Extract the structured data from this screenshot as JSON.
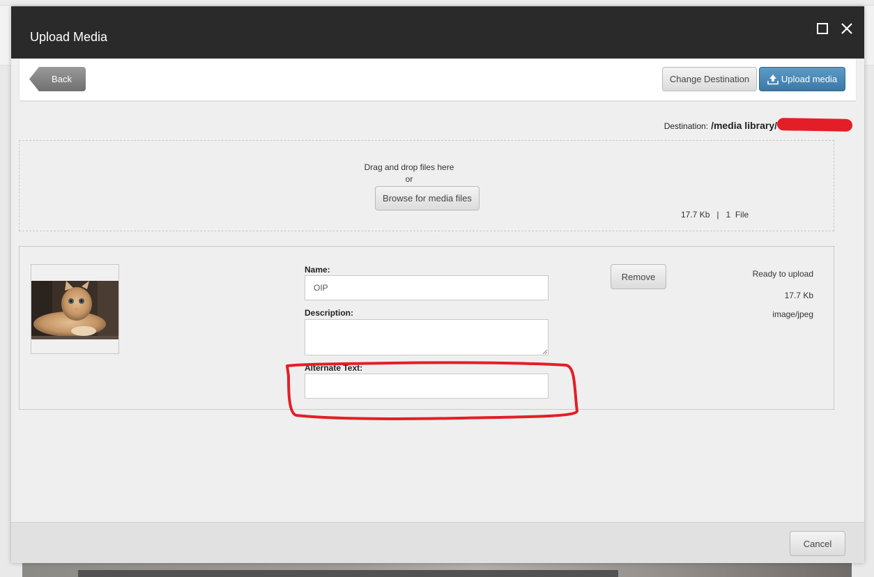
{
  "dialog": {
    "title": "Upload Media",
    "window_controls": {
      "maximize_icon": "maximize-square-icon",
      "close_icon": "close-x-icon"
    }
  },
  "toolbar": {
    "back_label": "Back",
    "change_destination_label": "Change Destination",
    "upload_label": "Upload media",
    "upload_icon": "upload-arrow-icon",
    "upload_color": "#4a88b8"
  },
  "destination": {
    "label": "Destination:",
    "path": "/media library/"
  },
  "dropzone": {
    "instruction": "Drag and drop files here",
    "or": "or",
    "browse_label": "Browse for media files",
    "summary": "17.7 Kb   |   1  File"
  },
  "file": {
    "thumbnail_alt": "kitten photo",
    "fields": {
      "name_label": "Name:",
      "name_value": "OIP",
      "description_label": "Description:",
      "description_value": "",
      "alt_label": "Alternate Text:",
      "alt_value": ""
    },
    "remove_label": "Remove",
    "status": "Ready to upload",
    "size": "17.7 Kb",
    "mime": "image/jpeg"
  },
  "annotation": {
    "color": "#e41e26",
    "target": "Alternate Text field"
  },
  "footer": {
    "cancel_label": "Cancel"
  }
}
